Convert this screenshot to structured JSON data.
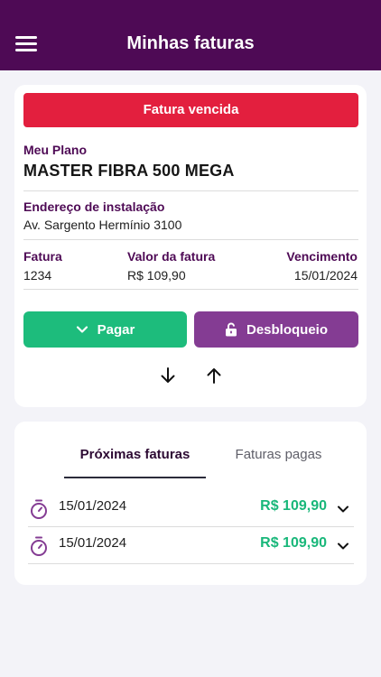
{
  "header": {
    "title": "Minhas faturas",
    "menu_icon": "hamburger-menu-icon"
  },
  "invoice_card": {
    "status_banner": "Fatura vencida",
    "plan_label": "Meu Plano",
    "plan_name": "MASTER FIBRA 500 MEGA",
    "address_label": "Endereço de instalação",
    "address_value": "Av. Sargento Hermínio 3100",
    "invoice_label": "Fatura",
    "invoice_number": "1234",
    "amount_label": "Valor da fatura",
    "amount_value": "R$ 109,90",
    "due_label": "Vencimento",
    "due_value": "15/01/2024",
    "pay_button": "Pagar",
    "unlock_button": "Desbloqueio"
  },
  "tabs": [
    {
      "label": "Próximas faturas",
      "active": true
    },
    {
      "label": "Faturas pagas",
      "active": false
    }
  ],
  "upcoming": [
    {
      "date": "15/01/2024",
      "amount": "R$ 109,90"
    },
    {
      "date": "15/01/2024",
      "amount": "R$ 109,90"
    }
  ],
  "colors": {
    "header": "#4e0a55",
    "overdue": "#e31f3e",
    "pay": "#1dbc7c",
    "unlock": "#843c93",
    "amount": "#19b77a"
  }
}
